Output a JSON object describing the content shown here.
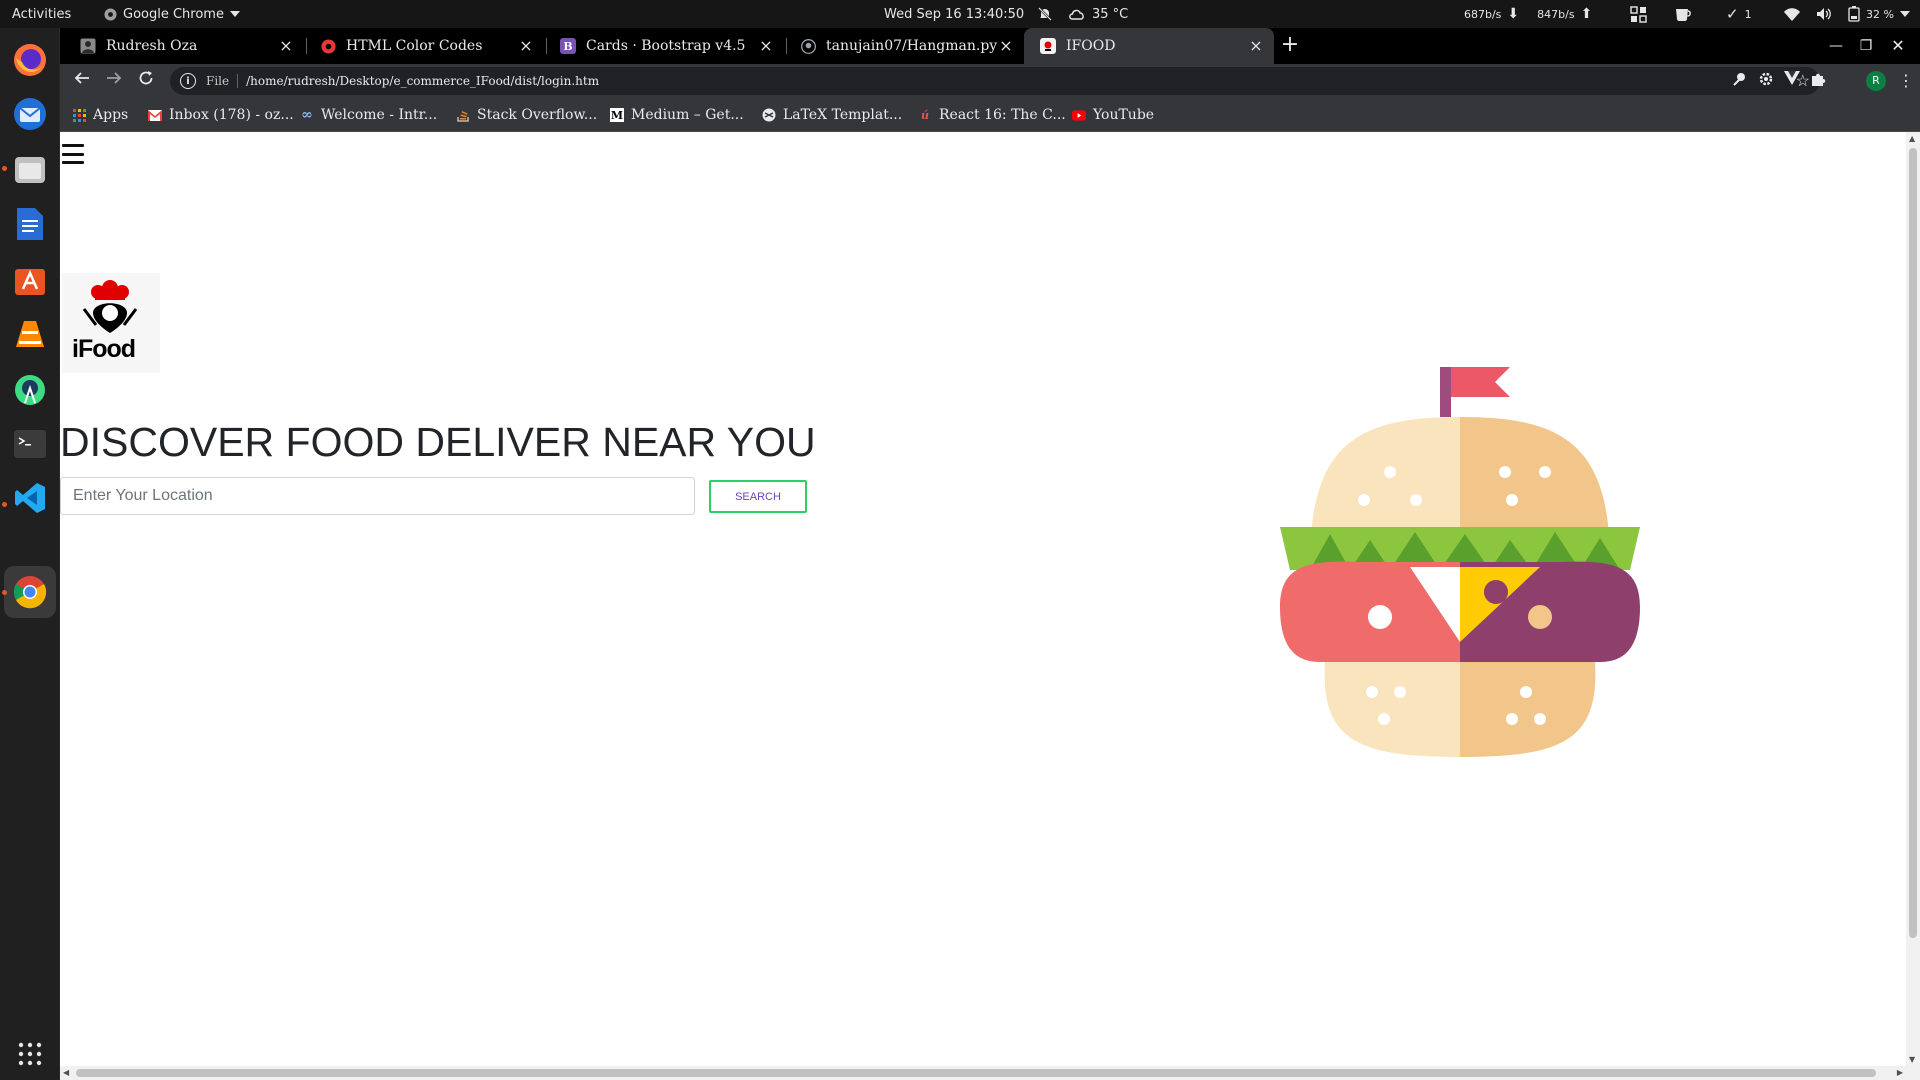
{
  "topbar": {
    "activities": "Activities",
    "app_name": "Google Chrome",
    "clock": "Wed Sep 16  13:40:50",
    "weather": "35 °C",
    "net_down": "687b/s",
    "net_up": "847b/s",
    "updates_count": "1",
    "battery": "32 %"
  },
  "dock": {
    "apps": [
      "firefox",
      "thunderbird",
      "files",
      "libreoffice-writer",
      "software-center",
      "vlc",
      "android-studio",
      "terminal",
      "vscode",
      "chrome",
      "show-applications"
    ]
  },
  "browser": {
    "tabs": [
      {
        "title": "Rudresh Oza",
        "icon": "portrait-icon",
        "active": false
      },
      {
        "title": "HTML Color Codes",
        "icon": "color-wheel-icon",
        "active": false
      },
      {
        "title": "Cards · Bootstrap v4.5",
        "icon": "bootstrap-icon",
        "active": false
      },
      {
        "title": "tanujain07/Hangman.py",
        "icon": "github-icon",
        "active": false
      },
      {
        "title": "IFOOD",
        "icon": "ifood-icon",
        "active": true
      }
    ],
    "address": {
      "scheme_label": "File",
      "url": "/home/rudresh/Desktop/e_commerce_IFood/dist/login.htm"
    },
    "bookmarks": [
      {
        "label": "Apps",
        "icon": "apps-grid-icon"
      },
      {
        "label": "Inbox (178) - oz...",
        "icon": "gmail-icon"
      },
      {
        "label": "Welcome - Intr...",
        "icon": "infinity-icon"
      },
      {
        "label": "Stack Overflow...",
        "icon": "stackoverflow-icon"
      },
      {
        "label": "Medium – Get...",
        "icon": "medium-icon"
      },
      {
        "label": "LaTeX Templat...",
        "icon": "latex-icon"
      },
      {
        "label": "React 16: The C...",
        "icon": "udemy-icon"
      },
      {
        "label": "YouTube",
        "icon": "youtube-icon"
      }
    ],
    "profile_initial": "R"
  },
  "page": {
    "logo_text": "iFood",
    "headline": "DISCOVER FOOD DELIVER NEAR YOU",
    "search_placeholder": "Enter Your Location",
    "search_value": "",
    "search_button": "SEARCH"
  },
  "colors": {
    "search_border": "#28d168",
    "search_text": "#6f42c1",
    "dock_active_dot": "#e95420",
    "chrome_tabstrip": "#000000",
    "chrome_toolbar": "#35363a"
  }
}
